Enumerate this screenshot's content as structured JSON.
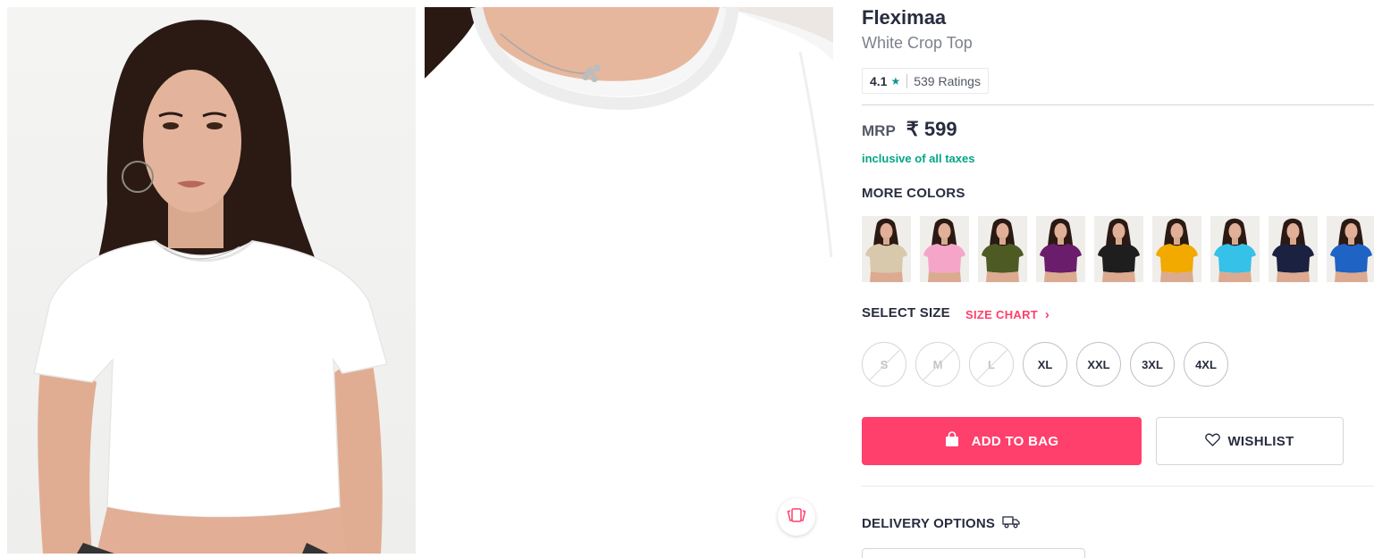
{
  "product": {
    "brand": "Fleximaa",
    "name": "White Crop Top",
    "rating": {
      "value": "4.1",
      "star": "★",
      "count": "539 Ratings"
    },
    "price": {
      "label": "MRP",
      "amount": "₹ 599"
    },
    "tax_note": "inclusive of all taxes"
  },
  "more_colors": {
    "heading": "MORE COLORS",
    "swatches": [
      {
        "name": "beige",
        "color": "#d8c9ad"
      },
      {
        "name": "pink",
        "color": "#f5a6c8"
      },
      {
        "name": "olive",
        "color": "#4d5a24"
      },
      {
        "name": "purple",
        "color": "#6a1d6b"
      },
      {
        "name": "black",
        "color": "#1e1e1e"
      },
      {
        "name": "mustard",
        "color": "#f2a900"
      },
      {
        "name": "sky-blue",
        "color": "#35c1e8"
      },
      {
        "name": "navy",
        "color": "#1b2140"
      },
      {
        "name": "royal-blue",
        "color": "#1f63c4"
      }
    ]
  },
  "size": {
    "heading": "SELECT SIZE",
    "chart_link": "SIZE CHART",
    "chart_chevron": "›",
    "options": [
      {
        "label": "S",
        "available": false
      },
      {
        "label": "M",
        "available": false
      },
      {
        "label": "L",
        "available": false
      },
      {
        "label": "XL",
        "available": true
      },
      {
        "label": "XXL",
        "available": true
      },
      {
        "label": "3XL",
        "available": true
      },
      {
        "label": "4XL",
        "available": true
      }
    ]
  },
  "actions": {
    "add_to_bag": "ADD TO BAG",
    "wishlist": "WISHLIST"
  },
  "delivery": {
    "heading": "DELIVERY OPTIONS"
  },
  "icons": {
    "rating": "star-icon",
    "bag": "shopping-bag-icon",
    "wishlist": "heart-icon",
    "delivery": "truck-icon",
    "similar": "view-similar-icon",
    "size_chart": "chevron-right-icon"
  },
  "colors": {
    "accent": "#ff3f6c",
    "rating_star": "#14958f",
    "tax_note": "#03a685"
  }
}
